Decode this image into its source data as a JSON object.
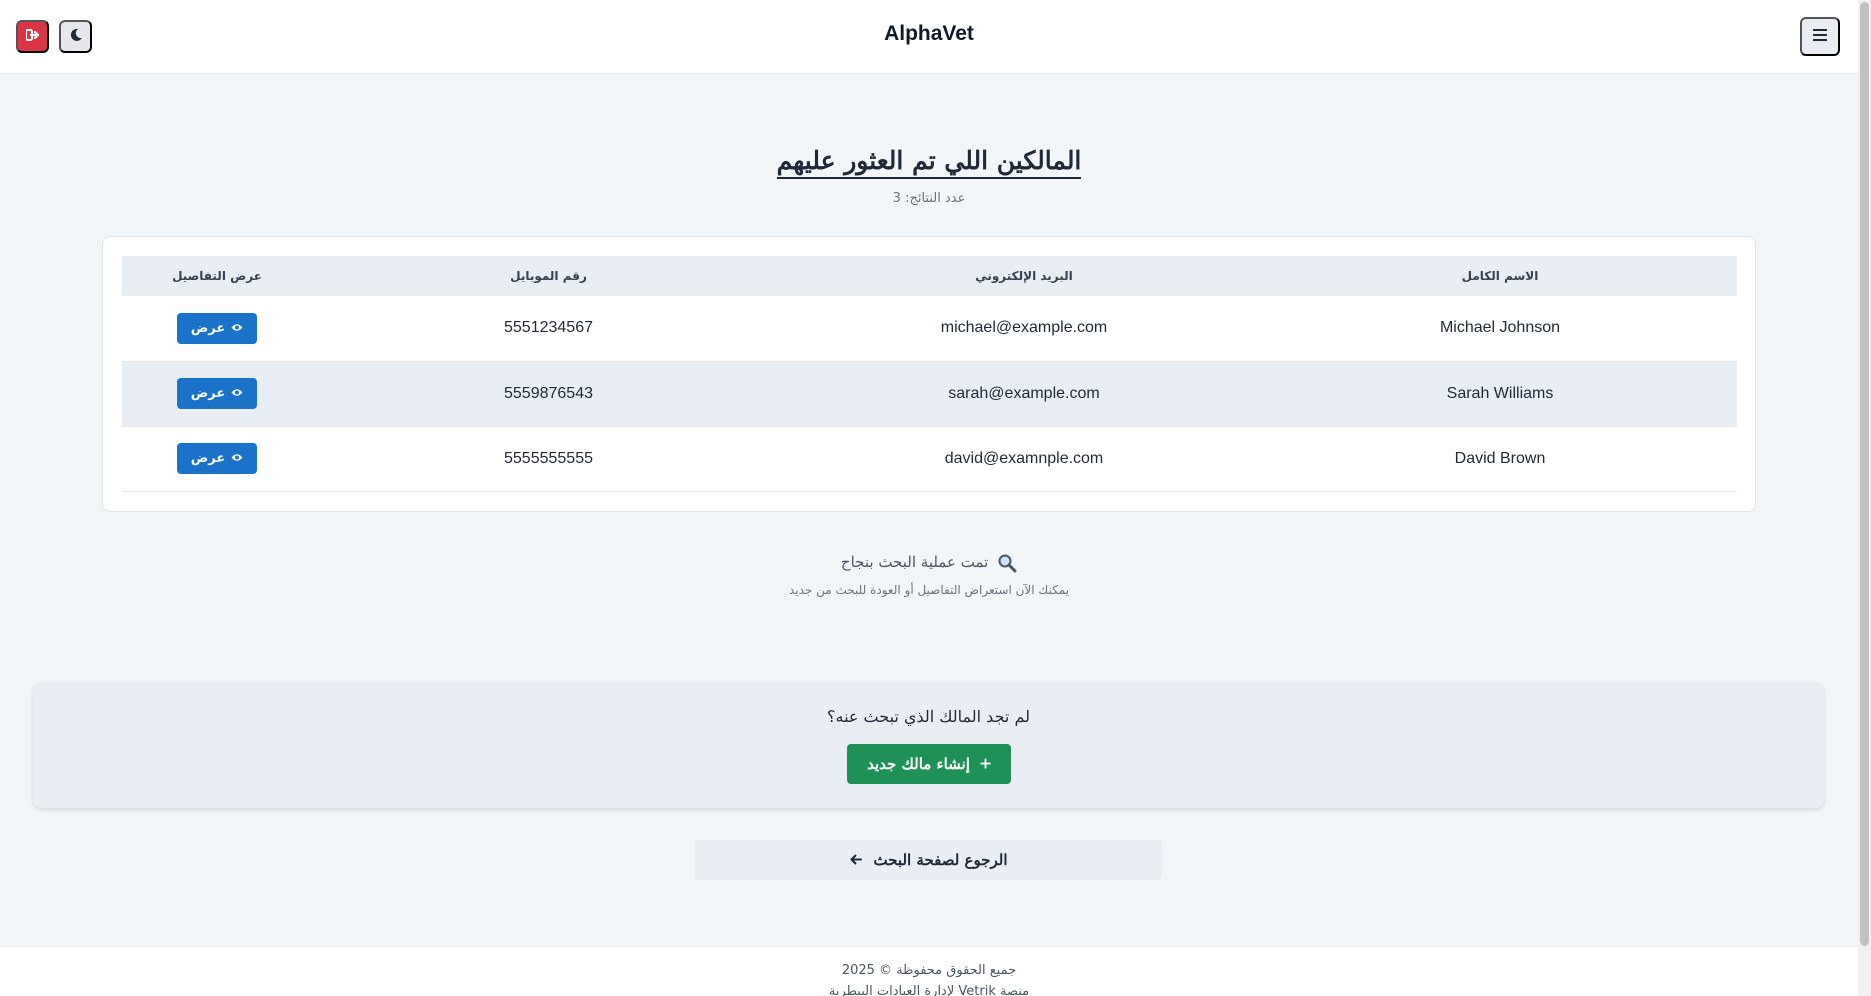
{
  "header": {
    "brand": "AlphaVet",
    "colors": {
      "logout": "#dc3545",
      "theme": "#e5e7eb",
      "menu": "#e9edf2"
    },
    "icons": {
      "logout": "sign-out-icon",
      "theme": "moon-icon",
      "menu": "hamburger-menu-icon"
    }
  },
  "main": {
    "title": "المالكين اللي تم العثور عليهم",
    "count_label": "عدد النتائج: 3"
  },
  "table": {
    "headers": {
      "name": "الاسم الكامل",
      "email": "البريد الإلكتروني",
      "phone": "رقم الموبايل",
      "view": "عرض التفاصيل"
    },
    "view_label": "عرض",
    "rows": [
      {
        "name": "Michael Johnson",
        "email": "michael@example.com",
        "phone": "5551234567"
      },
      {
        "name": "Sarah Williams",
        "email": "sarah@example.com",
        "phone": "5559876543"
      },
      {
        "name": "David Brown",
        "email": "david@examnple.com",
        "phone": "5555555555"
      }
    ],
    "accent": "#1a73c9"
  },
  "status": {
    "success": "تمت عملية البحث بنجاح",
    "hint": "يمكنك الآن استعراض التفاصيل أو العودة للبحث من جديد",
    "icon": "magnifier-icon"
  },
  "cta": {
    "question": "لم تجد المالك الذي تبحث عنه؟",
    "create_label": "إنشاء مالك جديد",
    "create_color": "#1e9157"
  },
  "back": {
    "label": "الرجوع لصفحة البحث"
  },
  "footer": {
    "copyright": "جميع الحقوق محفوظة © 2025",
    "platform": "منصة Vetrik لإدارة العيادات البيطرية"
  }
}
